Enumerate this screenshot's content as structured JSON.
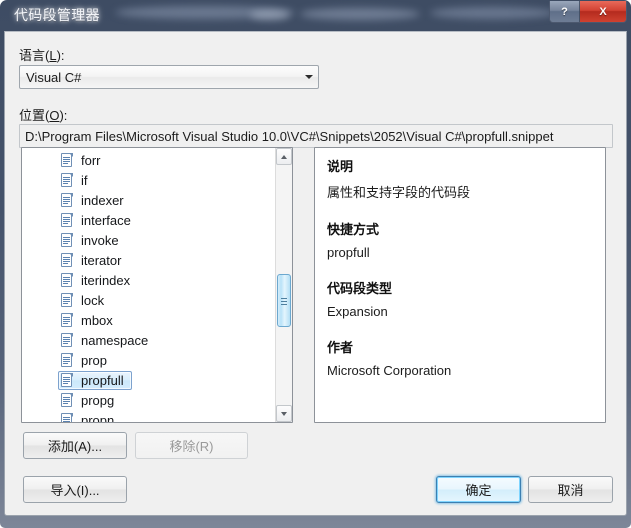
{
  "window": {
    "title": "代码段管理器",
    "help_button": "?",
    "close_button": "X"
  },
  "language": {
    "label_prefix": "语言(",
    "label_accel": "L",
    "label_suffix": "):",
    "selected": "Visual C#"
  },
  "location": {
    "label_prefix": "位置(",
    "label_accel": "O",
    "label_suffix": "):",
    "path": "D:\\Program Files\\Microsoft Visual Studio 10.0\\VC#\\Snippets\\2052\\Visual C#\\propfull.snippet"
  },
  "tree": {
    "icon": "document-icon",
    "items": [
      {
        "label": "forr",
        "selected": false
      },
      {
        "label": "if",
        "selected": false
      },
      {
        "label": "indexer",
        "selected": false
      },
      {
        "label": "interface",
        "selected": false
      },
      {
        "label": "invoke",
        "selected": false
      },
      {
        "label": "iterator",
        "selected": false
      },
      {
        "label": "iterindex",
        "selected": false
      },
      {
        "label": "lock",
        "selected": false
      },
      {
        "label": "mbox",
        "selected": false
      },
      {
        "label": "namespace",
        "selected": false
      },
      {
        "label": "prop",
        "selected": false
      },
      {
        "label": "propfull",
        "selected": true
      },
      {
        "label": "propg",
        "selected": false
      },
      {
        "label": "propn",
        "selected": false
      }
    ],
    "scrollbar": {
      "up_icon": "chevron-up-icon",
      "down_icon": "chevron-down-icon"
    }
  },
  "details": [
    {
      "heading": "说明",
      "value": "属性和支持字段的代码段"
    },
    {
      "heading": "快捷方式",
      "value": "propfull"
    },
    {
      "heading": "代码段类型",
      "value": "Expansion"
    },
    {
      "heading": "作者",
      "value": "Microsoft Corporation"
    }
  ],
  "buttons": {
    "add": "添加(A)...",
    "remove": "移除(R)",
    "import": "导入(I)...",
    "ok": "确定",
    "cancel": "取消"
  },
  "colors": {
    "titlebar": "#45536b",
    "close_red": "#d24233",
    "selection_blue": "#7da2ce",
    "default_button_border": "#3c7fb1"
  }
}
